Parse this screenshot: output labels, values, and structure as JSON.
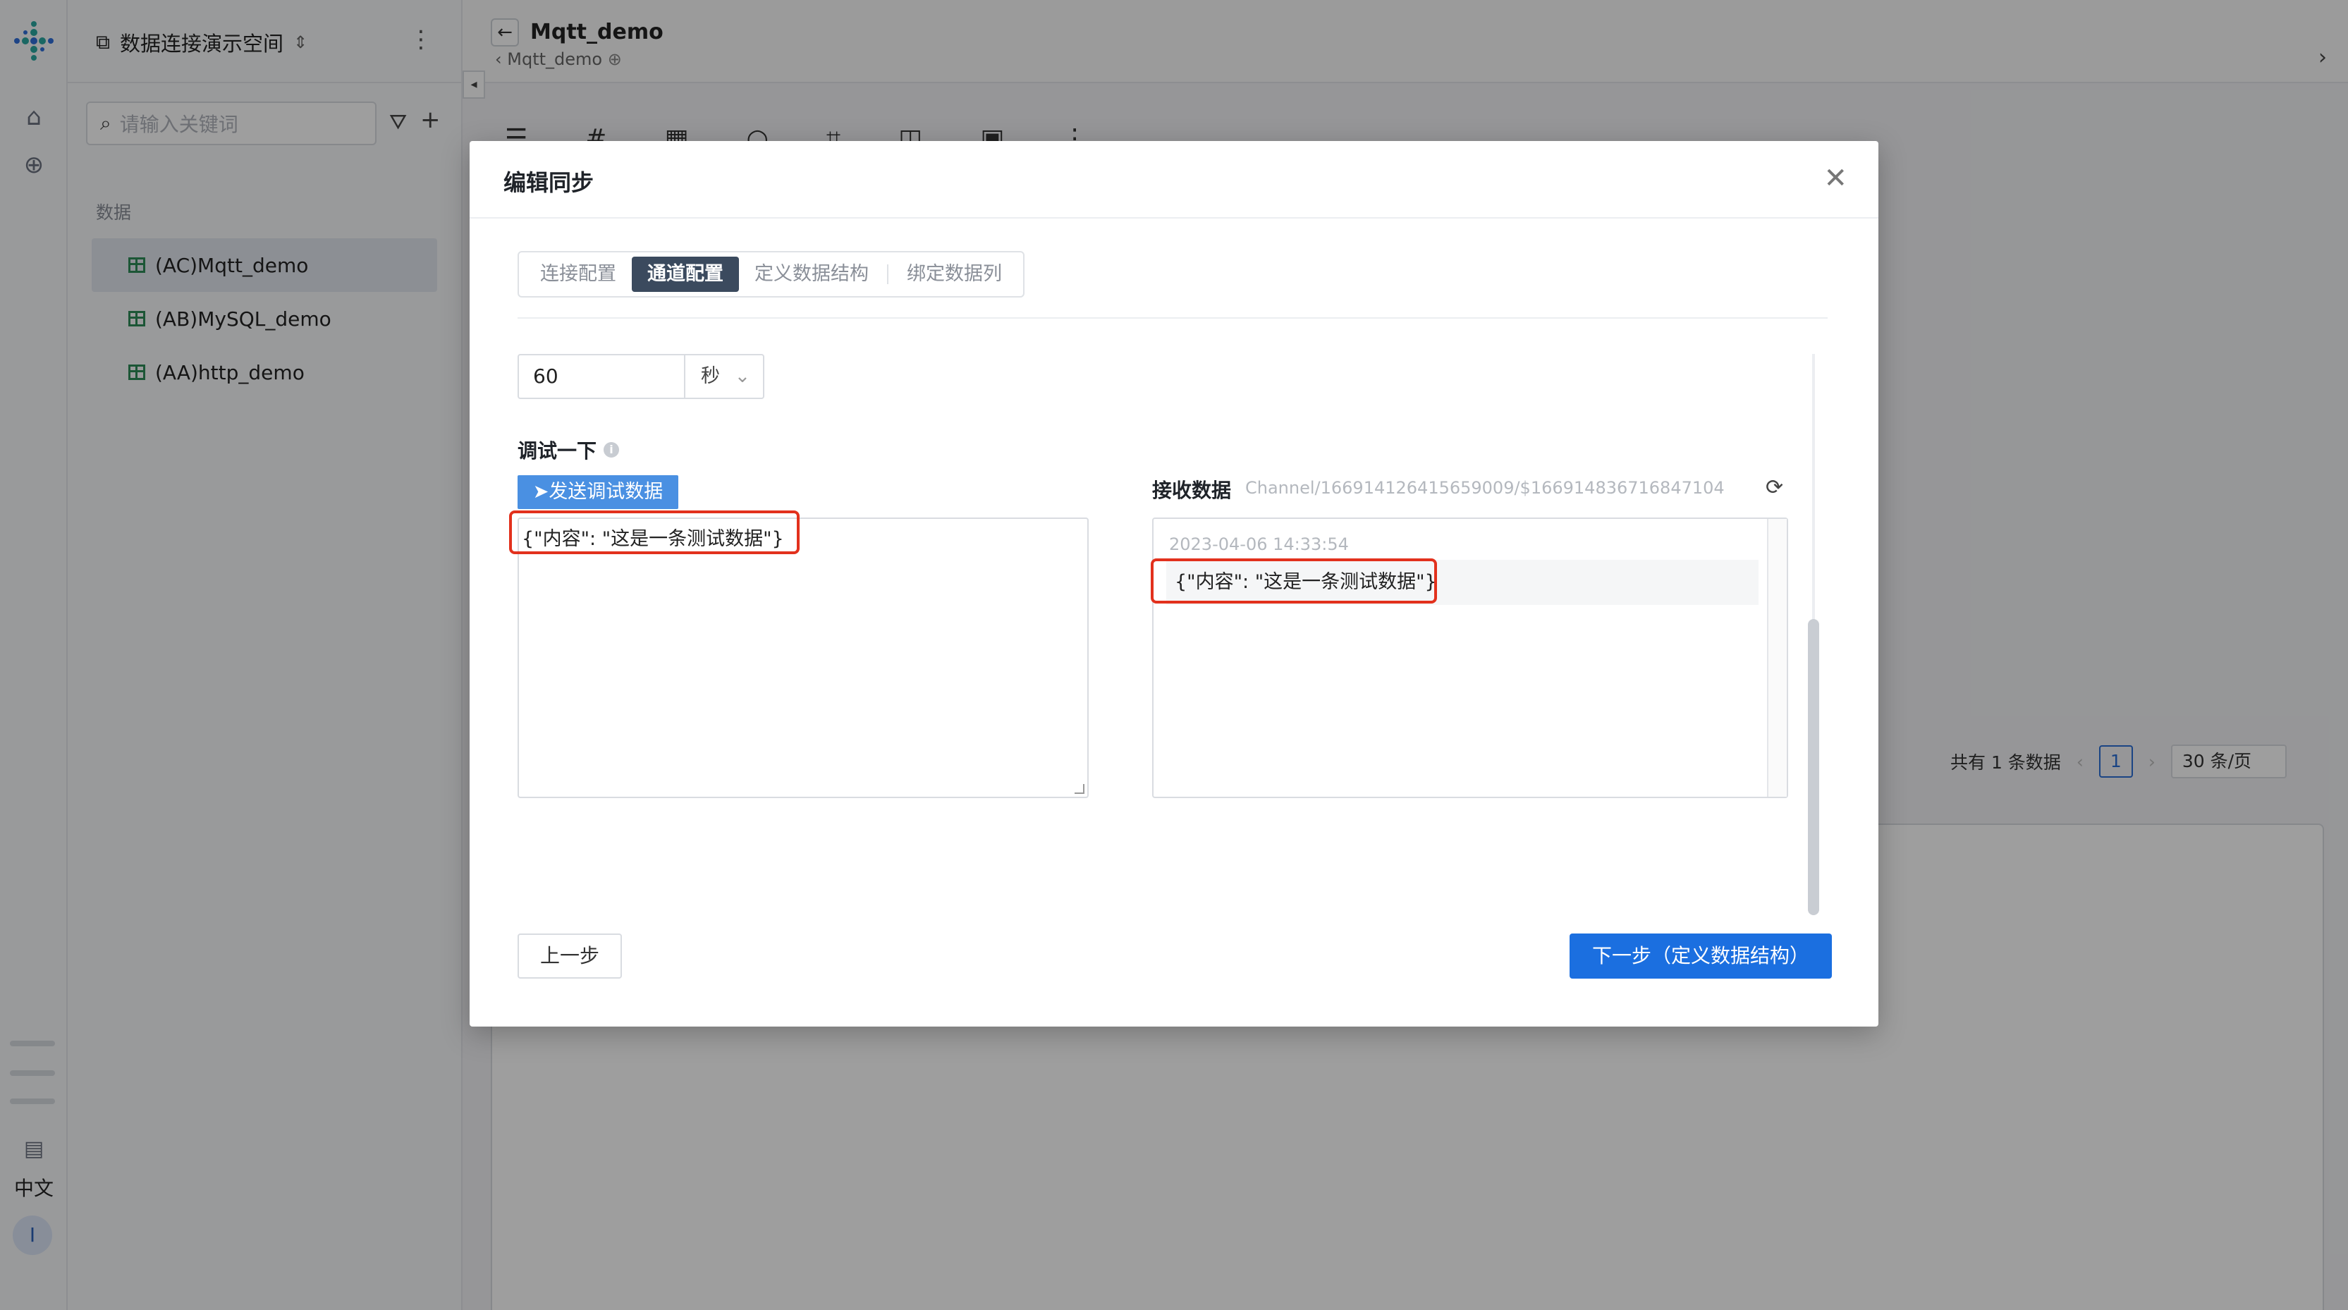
{
  "sidebar": {
    "workspace": "数据连接演示空间",
    "search_placeholder": "请输入关键词",
    "section": "数据",
    "items": [
      {
        "label": "(AC)Mqtt_demo"
      },
      {
        "label": "(AB)MySQL_demo"
      },
      {
        "label": "(AA)http_demo"
      }
    ]
  },
  "rail": {
    "lang": "中文",
    "avatar": "I"
  },
  "header": {
    "title": "Mqtt_demo",
    "breadcrumb": "Mqtt_demo"
  },
  "pager": {
    "total": "共有 1 条数据",
    "page": "1",
    "size": "30 条/页"
  },
  "modal": {
    "title": "编辑同步",
    "tabs": [
      {
        "label": "连接配置"
      },
      {
        "label": "通道配置"
      },
      {
        "label": "定义数据结构"
      },
      {
        "label": "绑定数据列"
      }
    ],
    "interval_value": "60",
    "interval_unit": "秒",
    "debug_label": "调试一下",
    "send_button": "发送调试数据",
    "send_payload": "{\"内容\": \"这是一条测试数据\"}",
    "receive_label": "接收数据",
    "channel": "Channel/1669141264156590​09/$1669148367168471​04",
    "received_time": "2023-04-06 14:33:54",
    "received_payload": "{\"内容\": \"这是一条测试数据\"}",
    "prev_button": "上一步",
    "next_button": "下一步（定义数据结构）"
  },
  "colors": {
    "accent": "#1b6fe0",
    "highlight": "#e2311d",
    "tab_active": "#3b4a5e"
  }
}
